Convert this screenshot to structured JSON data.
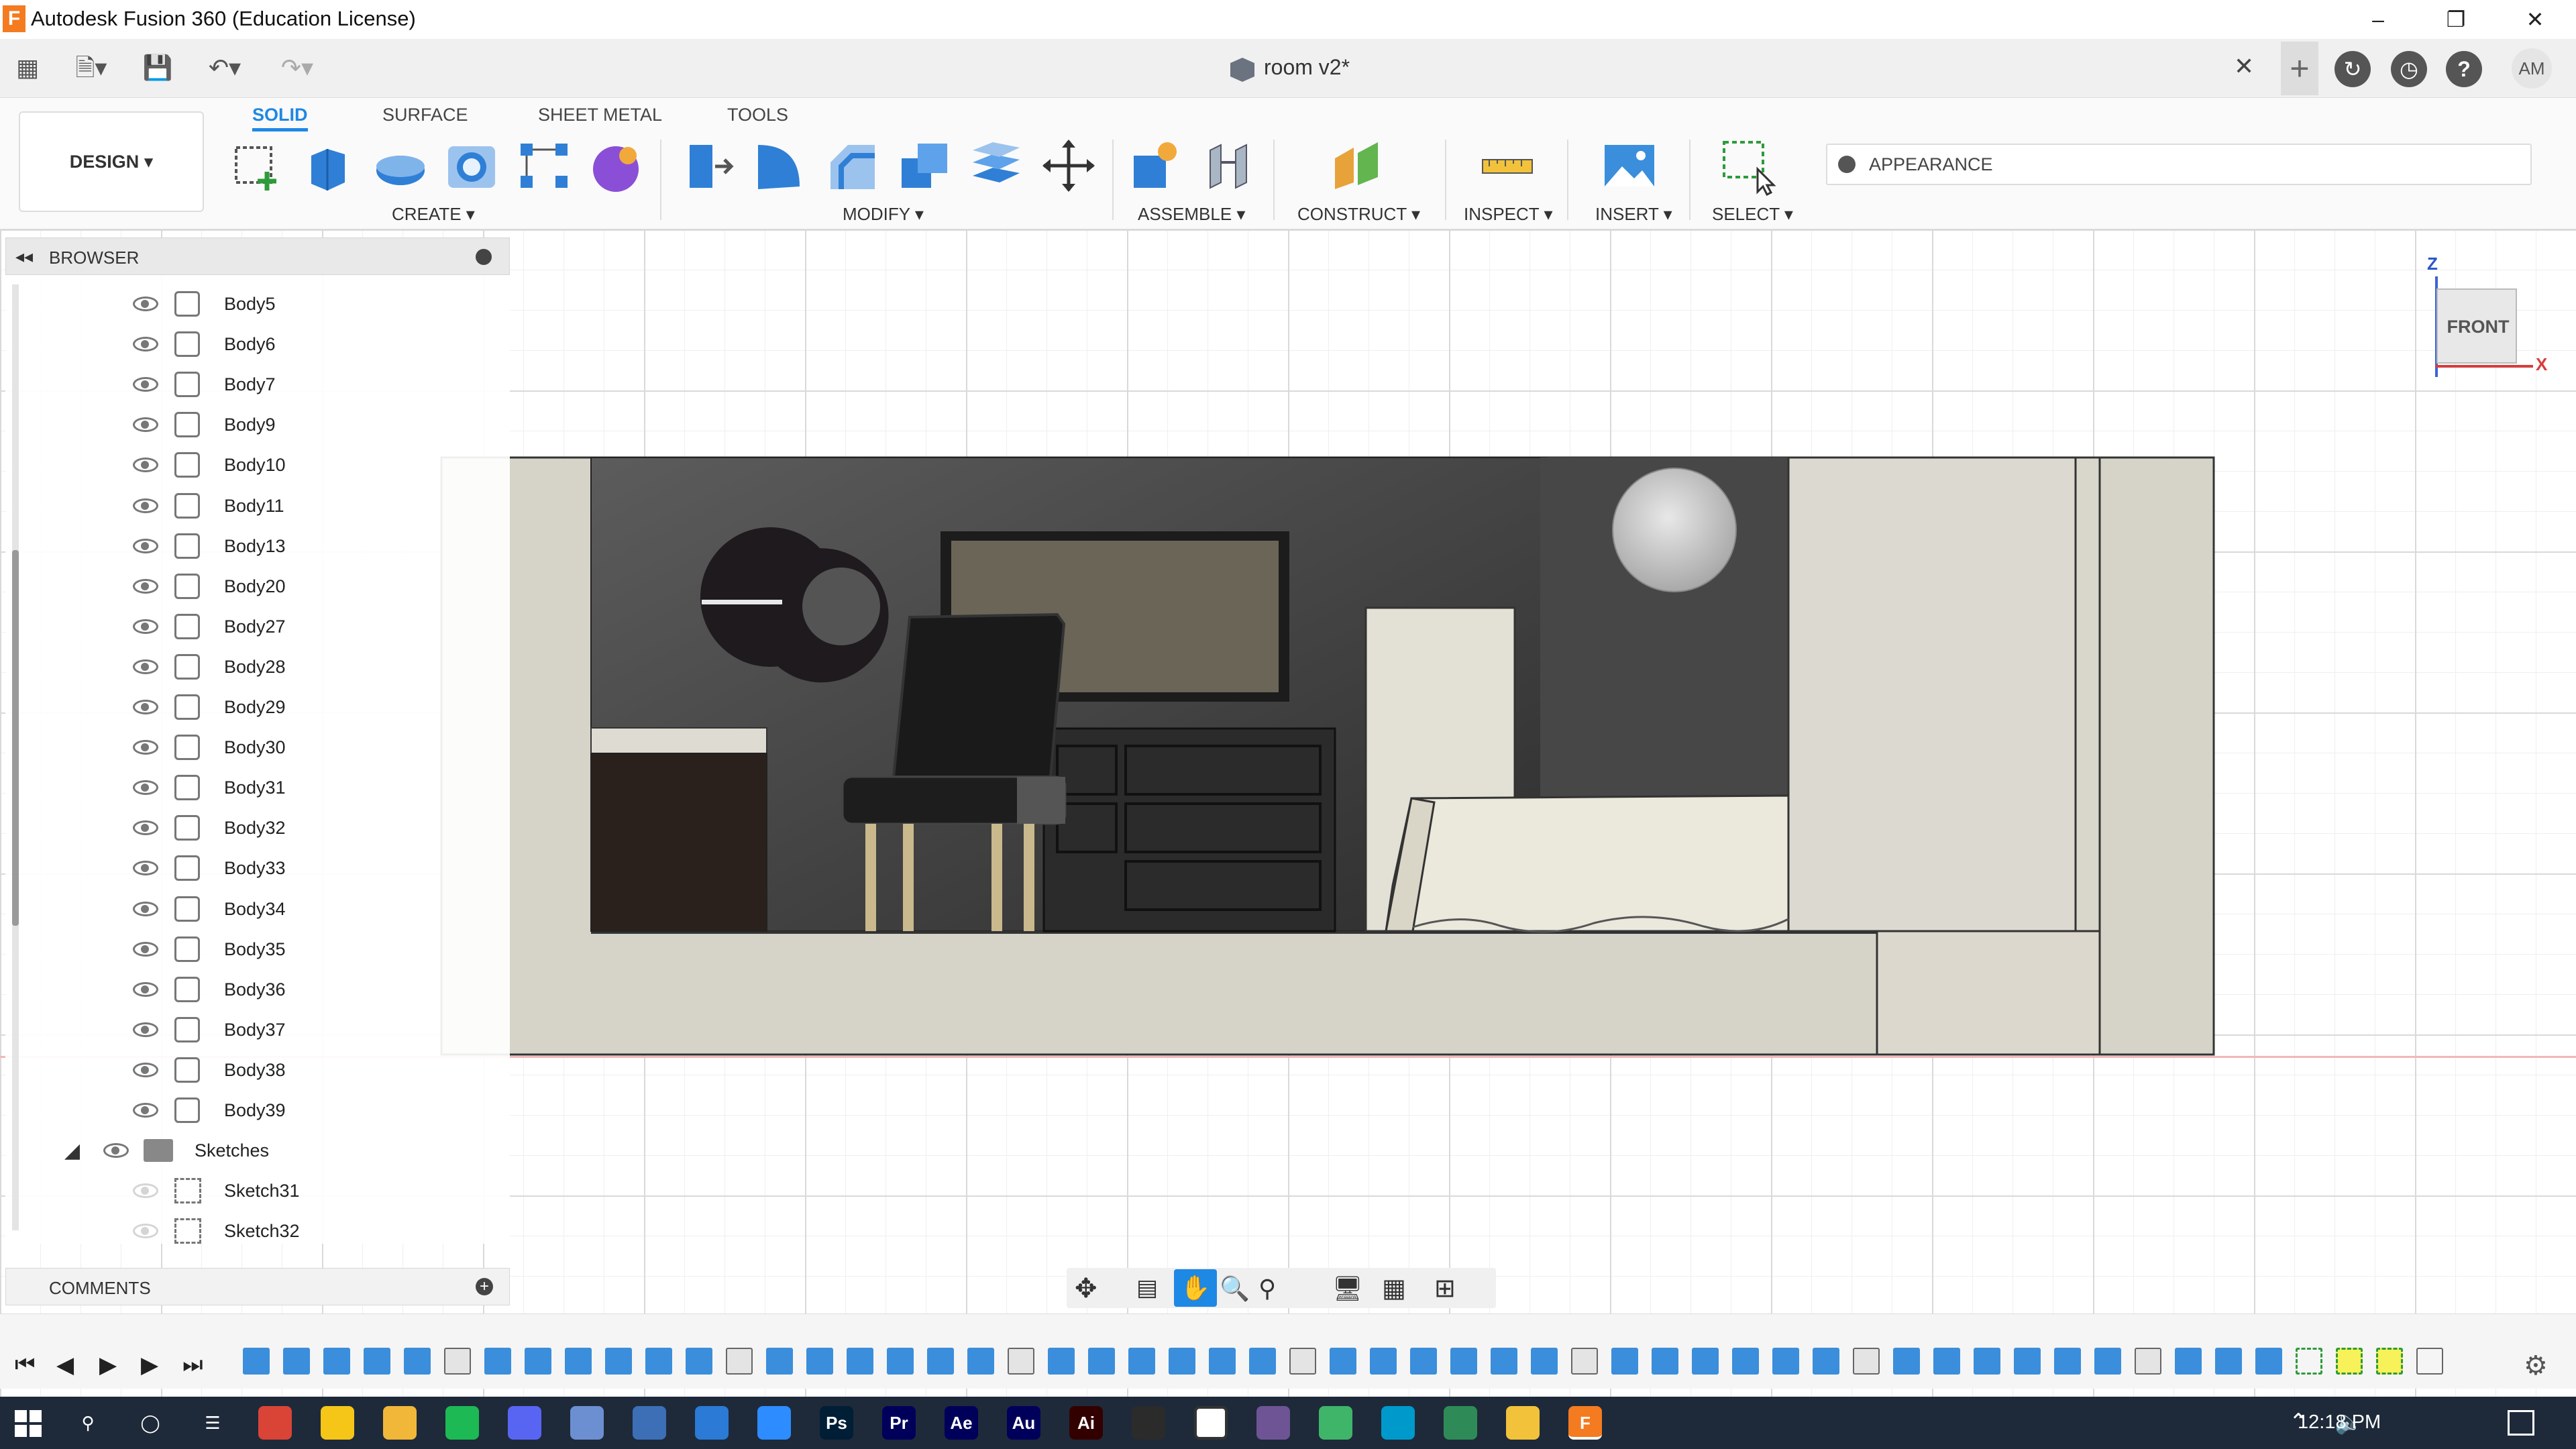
{
  "window": {
    "title": "Autodesk Fusion 360 (Education License)",
    "app_icon_letter": "F"
  },
  "document": {
    "name": "room v2*"
  },
  "user": {
    "initials": "AM"
  },
  "ribbon": {
    "tabs": [
      "SOLID",
      "SURFACE",
      "SHEET METAL",
      "TOOLS"
    ],
    "active_tab": "SOLID",
    "workspace": "DESIGN ▾",
    "groups": [
      "CREATE ▾",
      "MODIFY ▾",
      "ASSEMBLE ▾",
      "CONSTRUCT ▾",
      "INSPECT ▾",
      "INSERT ▾",
      "SELECT ▾"
    ],
    "search_label": "APPEARANCE"
  },
  "browser": {
    "title": "BROWSER",
    "bodies": [
      "Body5",
      "Body6",
      "Body7",
      "Body9",
      "Body10",
      "Body11",
      "Body13",
      "Body20",
      "Body27",
      "Body28",
      "Body29",
      "Body30",
      "Body31",
      "Body32",
      "Body33",
      "Body34",
      "Body35",
      "Body36",
      "Body37",
      "Body38",
      "Body39"
    ],
    "folder": "Sketches",
    "sketches": [
      "Sketch31",
      "Sketch32"
    ]
  },
  "comments": {
    "label": "COMMENTS"
  },
  "viewcube": {
    "face": "FRONT",
    "axis_z": "Z",
    "axis_x": "X"
  },
  "taskbar": {
    "time": "12:18 PM"
  },
  "icons": [
    "grid-icon",
    "file-icon",
    "save-icon",
    "undo-icon",
    "redo-icon",
    "close-icon",
    "plus-icon",
    "refresh-icon",
    "clock-icon",
    "help-icon"
  ],
  "colors": {
    "accent": "#1e88e5",
    "taskbar": "#1e2a3a",
    "fusion": "#f47b20"
  }
}
